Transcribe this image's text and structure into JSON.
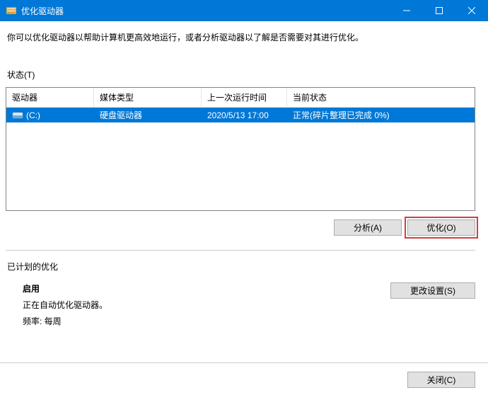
{
  "titlebar": {
    "title": "优化驱动器"
  },
  "description": "你可以优化驱动器以帮助计算机更高效地运行，或者分析驱动器以了解是否需要对其进行优化。",
  "status_label": "状态(T)",
  "table": {
    "headers": {
      "drive": "驱动器",
      "media": "媒体类型",
      "last_run": "上一次运行时间",
      "current_status": "当前状态"
    },
    "rows": [
      {
        "drive": "(C:)",
        "media": "硬盘驱动器",
        "last_run": "2020/5/13 17:00",
        "status": "正常(碎片整理已完成 0%)"
      }
    ]
  },
  "buttons": {
    "analyze": "分析(A)",
    "optimize": "优化(O)",
    "change_settings": "更改设置(S)",
    "close": "关闭(C)"
  },
  "scheduled": {
    "title": "已计划的优化",
    "enable": "启用",
    "description": "正在自动优化驱动器。",
    "frequency": "频率: 每周"
  }
}
